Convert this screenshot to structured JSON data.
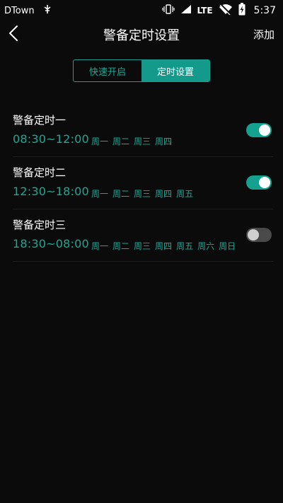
{
  "status_bar": {
    "carrier": "DTown",
    "network": "LTE",
    "time": "5:37"
  },
  "header": {
    "title": "警备定时设置",
    "add_label": "添加"
  },
  "tabs": [
    {
      "label": "快速开启",
      "active": false
    },
    {
      "label": "定时设置",
      "active": true
    }
  ],
  "schedules": [
    {
      "name": "警备定时一",
      "time": "08:30~12:00",
      "days": [
        "周一",
        "周二",
        "周三",
        "周四"
      ],
      "enabled": true
    },
    {
      "name": "警备定时二",
      "time": "12:30~18:00",
      "days": [
        "周一",
        "周二",
        "周三",
        "周四",
        "周五"
      ],
      "enabled": true
    },
    {
      "name": "警备定时三",
      "time": "18:30~08:00",
      "days": [
        "周一",
        "周二",
        "周三",
        "周四",
        "周五",
        "周六",
        "周日"
      ],
      "enabled": false
    }
  ],
  "colors": {
    "accent": "#149a8b",
    "accent_text": "#1fa896",
    "background": "#0b0b0b",
    "toggle_off": "#4a4a4a"
  }
}
